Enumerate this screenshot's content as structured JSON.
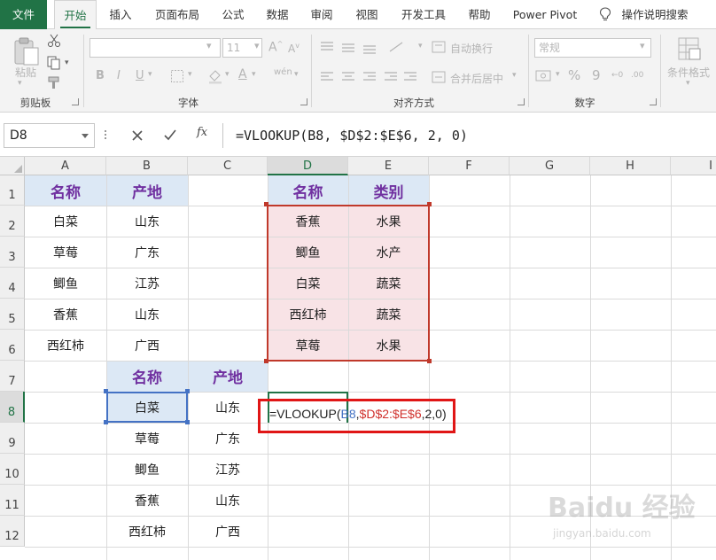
{
  "tabs": {
    "file": "文件",
    "home": "开始",
    "insert": "插入",
    "page_layout": "页面布局",
    "formulas": "公式",
    "data": "数据",
    "review": "审阅",
    "view": "视图",
    "developer": "开发工具",
    "help": "帮助",
    "power_pivot": "Power Pivot",
    "tell_me": "操作说明搜索"
  },
  "ribbon": {
    "paste_label": "粘贴",
    "clipboard_group": "剪贴板",
    "font_group": "字体",
    "font_size": "11",
    "bold": "B",
    "italic": "I",
    "underline": "U",
    "wen": "wén",
    "align_group": "对齐方式",
    "wrap_text": "自动换行",
    "merge_center": "合并后居中",
    "number_group": "数字",
    "number_format": "常规",
    "percent": "%",
    "comma": "9",
    "cond_format": "条件格式"
  },
  "formula_bar": {
    "name_box": "D8",
    "fx": "fx",
    "formula": "=VLOOKUP(B8, $D$2:$E$6, 2, 0)"
  },
  "columns": [
    "A",
    "B",
    "C",
    "D",
    "E",
    "F",
    "G",
    "H",
    "I"
  ],
  "rows": [
    "1",
    "2",
    "3",
    "4",
    "5",
    "6",
    "7",
    "8",
    "9",
    "10",
    "11",
    "12"
  ],
  "table1": {
    "headers": [
      "名称",
      "产地"
    ],
    "rows": [
      [
        "白菜",
        "山东"
      ],
      [
        "草莓",
        "广东"
      ],
      [
        "鲫鱼",
        "江苏"
      ],
      [
        "香蕉",
        "山东"
      ],
      [
        "西红柿",
        "广西"
      ]
    ]
  },
  "table2": {
    "headers": [
      "名称",
      "类别"
    ],
    "rows": [
      [
        "香蕉",
        "水果"
      ],
      [
        "鲫鱼",
        "水产"
      ],
      [
        "白菜",
        "蔬菜"
      ],
      [
        "西红柿",
        "蔬菜"
      ],
      [
        "草莓",
        "水果"
      ]
    ]
  },
  "table3": {
    "headers": [
      "名称",
      "产地"
    ],
    "rows": [
      [
        "白菜",
        "山东"
      ],
      [
        "草莓",
        "广东"
      ],
      [
        "鲫鱼",
        "江苏"
      ],
      [
        "香蕉",
        "山东"
      ],
      [
        "西红柿",
        "广西"
      ]
    ]
  },
  "cell_edit": {
    "prefix": "=VLOOKUP(",
    "arg1": "B8",
    "sep1": ",",
    "arg2": "$D$2:$E$6",
    "rest": ",2,0)"
  },
  "watermark": {
    "main": "Baidu 经验",
    "sub": "jingyan.baidu.com"
  }
}
